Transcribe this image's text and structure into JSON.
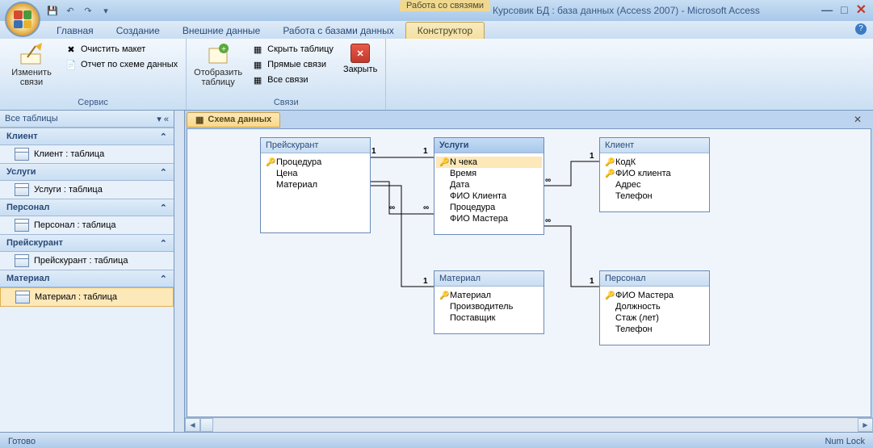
{
  "title_context": "Работа со связями",
  "title_main": "Курсовик БД : база данных (Access 2007) - Microsoft Access",
  "tabs": {
    "home": "Главная",
    "create": "Создание",
    "external": "Внешние данные",
    "dbtools": "Работа с базами данных",
    "constructor": "Конструктор"
  },
  "ribbon": {
    "edit_rel": "Изменить связи",
    "clear_layout": "Очистить макет",
    "schema_report": "Отчет по схеме данных",
    "group_service": "Сервис",
    "show_table": "Отобразить таблицу",
    "hide_table": "Скрыть таблицу",
    "direct_rel": "Прямые связи",
    "all_rel": "Все связи",
    "group_rel": "Связи",
    "close": "Закрыть"
  },
  "nav": {
    "header": "Все таблицы",
    "groups": [
      {
        "title": "Клиент",
        "items": [
          "Клиент : таблица"
        ]
      },
      {
        "title": "Услуги",
        "items": [
          "Услуги : таблица"
        ]
      },
      {
        "title": "Персонал",
        "items": [
          "Персонал : таблица"
        ]
      },
      {
        "title": "Прейскурант",
        "items": [
          "Прейскурант : таблица"
        ]
      },
      {
        "title": "Материал",
        "items": [
          "Материал : таблица"
        ]
      }
    ]
  },
  "doc_tab": "Схема данных",
  "tables": {
    "price": {
      "title": "Прейскурант",
      "fields": [
        "Процедура",
        "Цена",
        "Материал"
      ]
    },
    "service": {
      "title": "Услуги",
      "fields": [
        "N чека",
        "Время",
        "Дата",
        "ФИО Клиента",
        "Процедура",
        "ФИО Мастера"
      ]
    },
    "client": {
      "title": "Клиент",
      "fields": [
        "КодК",
        "ФИО клиента",
        "Адрес",
        "Телефон"
      ]
    },
    "material": {
      "title": "Материал",
      "fields": [
        "Материал",
        "Производитель",
        "Поставщик"
      ]
    },
    "staff": {
      "title": "Персонал",
      "fields": [
        "ФИО Мастера",
        "Должность",
        "Стаж (лет)",
        "Телефон"
      ]
    }
  },
  "status": {
    "left": "Готово",
    "right": "Num Lock"
  }
}
